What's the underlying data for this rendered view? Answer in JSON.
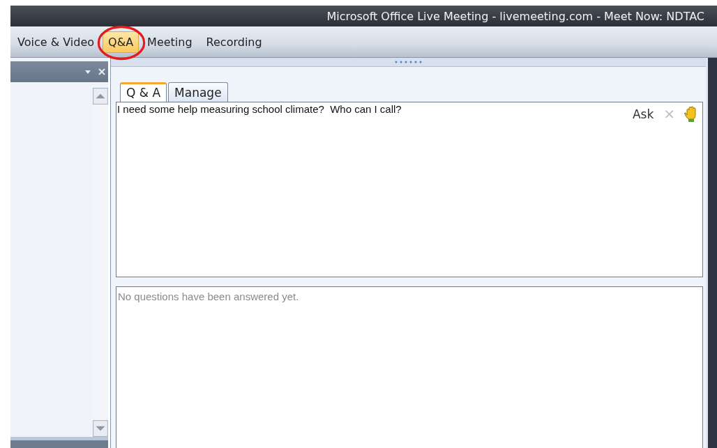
{
  "window": {
    "title": "Microsoft Office Live Meeting - livemeeting.com - Meet Now: NDTAC"
  },
  "menu": [
    {
      "label": "Voice & Video",
      "selected": false,
      "circled": false
    },
    {
      "label": "Q&A",
      "selected": true,
      "circled": true
    },
    {
      "label": "Meeting",
      "selected": false,
      "circled": false
    },
    {
      "label": "Recording",
      "selected": false,
      "circled": false
    }
  ],
  "tabs": [
    {
      "label": "Q & A",
      "selected": true
    },
    {
      "label": "Manage",
      "selected": false
    }
  ],
  "question": {
    "value": "I need some help measuring school climate?  Who can I call?"
  },
  "ask_button": {
    "label": "Ask"
  },
  "clear_button": {
    "label": "×",
    "disabled": true
  },
  "answers": {
    "empty_message": "No questions have been answered yet."
  }
}
